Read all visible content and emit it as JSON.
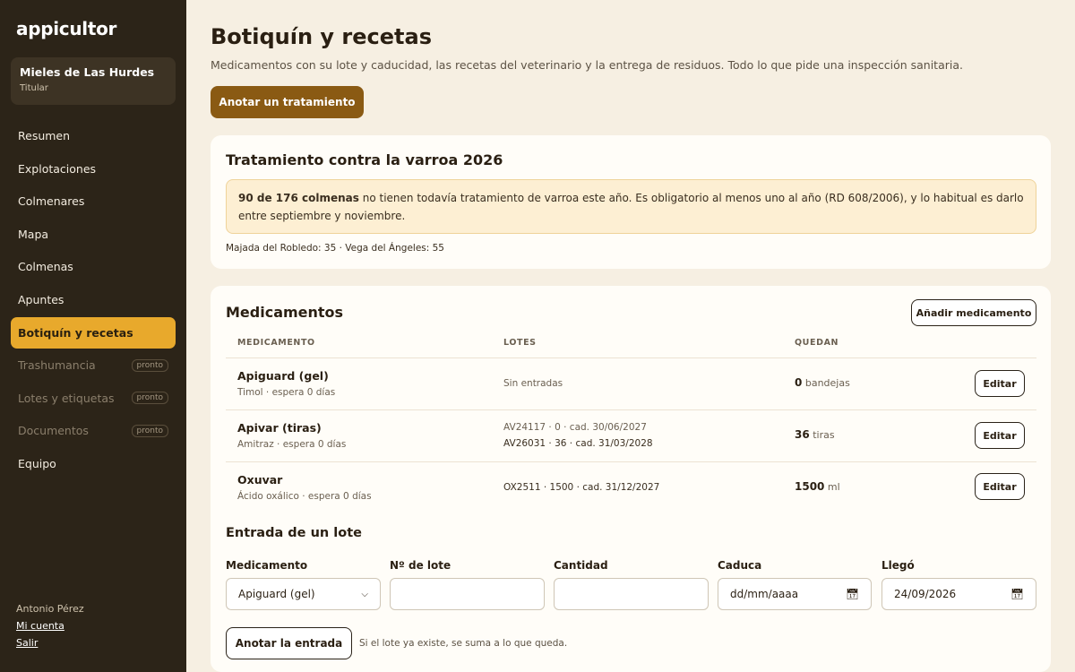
{
  "sidebar": {
    "brand": "appicultor",
    "org_name": "Mieles de Las Hurdes",
    "org_role": "Titular",
    "items": [
      {
        "label": "Resumen"
      },
      {
        "label": "Explotaciones"
      },
      {
        "label": "Colmenares"
      },
      {
        "label": "Mapa"
      },
      {
        "label": "Colmenas"
      },
      {
        "label": "Apuntes"
      },
      {
        "label": "Botiquín y recetas",
        "active": true
      },
      {
        "label": "Trashumancia",
        "badge": "pronto"
      },
      {
        "label": "Lotes y etiquetas",
        "badge": "pronto"
      },
      {
        "label": "Documentos",
        "badge": "pronto"
      },
      {
        "label": "Equipo"
      }
    ],
    "user_name": "Antonio Pérez",
    "my_account": "Mi cuenta",
    "logout": "Salir"
  },
  "header": {
    "title": "Botiquín y recetas",
    "subtitle": "Medicamentos con su lote y caducidad, las recetas del veterinario y la entrega de residuos. Todo lo que pide una inspección sanitaria.",
    "primary_action": "Anotar un tratamiento"
  },
  "varroa": {
    "title": "Tratamiento contra la varroa 2026",
    "alert_strong": "90 de 176 colmenas",
    "alert_rest": " no tienen todavía tratamiento de varroa este año. Es obligatorio al menos uno al año (RD 608/2006), y lo habitual es darlo entre septiembre y noviembre.",
    "footer": "Majada del Robledo: 35 · Vega del Ángeles: 55"
  },
  "medicines": {
    "title": "Medicamentos",
    "add_button": "Añadir medicamento",
    "columns": {
      "medicine": "MEDICAMENTO",
      "lots": "LOTES",
      "remaining": "QUEDAN"
    },
    "edit_label": "Editar",
    "rows": [
      {
        "name": "Apiguard (gel)",
        "detail": "Timol · espera 0 días",
        "lot1": "Sin entradas",
        "lot2": "",
        "qty": "0",
        "unit": "bandejas"
      },
      {
        "name": "Apivar (tiras)",
        "detail": "Amitraz · espera 0 días",
        "lot1": "AV24117 · 0 · cad. 30/06/2027",
        "lot2": "AV26031 · 36 · cad. 31/03/2028",
        "qty": "36",
        "unit": "tiras"
      },
      {
        "name": "Oxuvar",
        "detail": "Ácido oxálico · espera 0 días",
        "lot1": "OX2511 · 1500 · cad. 31/12/2027",
        "lot2": "",
        "qty": "1500",
        "unit": "ml"
      }
    ]
  },
  "lot_entry": {
    "title": "Entrada de un lote",
    "fields": {
      "medicine_label": "Medicamento",
      "medicine_value": "Apiguard (gel)",
      "lot_label": "Nº de lote",
      "lot_value": "",
      "qty_label": "Cantidad",
      "qty_value": "",
      "expiry_label": "Caduca",
      "expiry_value": "dd/mm/aaaa",
      "arrived_label": "Llegó",
      "arrived_value": "24/09/2026"
    },
    "submit": "Anotar la entrada",
    "hint": "Si el lote ya existe, se suma a lo que queda."
  }
}
